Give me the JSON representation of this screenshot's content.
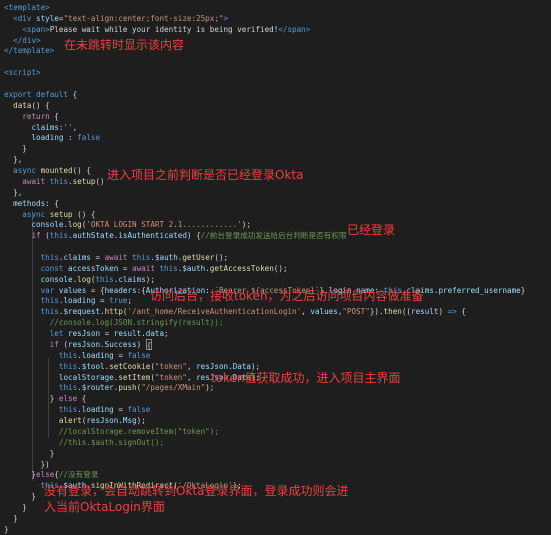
{
  "code": [
    [
      [
        "tag",
        "<template>"
      ]
    ],
    [
      [
        "txt",
        "  "
      ],
      [
        "tag",
        "<div "
      ],
      [
        "attr",
        "style"
      ],
      [
        "txt",
        "="
      ],
      [
        "str",
        "\"text-align:center;font-size:25px;\""
      ],
      [
        "tag",
        ">"
      ]
    ],
    [
      [
        "txt",
        "    "
      ],
      [
        "tag",
        "<span>"
      ],
      [
        "txt",
        "Please wait while your identity is being verified!"
      ],
      [
        "tag",
        "</span>"
      ]
    ],
    [
      [
        "txt",
        "  "
      ],
      [
        "tag",
        "</div>"
      ]
    ],
    [
      [
        "tag",
        "</template>"
      ]
    ],
    [
      [
        "txt",
        ""
      ]
    ],
    [
      [
        "tag",
        "<script>"
      ]
    ],
    [
      [
        "txt",
        ""
      ]
    ],
    [
      [
        "kw",
        "export default"
      ],
      [
        "txt",
        " {"
      ]
    ],
    [
      [
        "txt",
        "  "
      ],
      [
        "fn",
        "data"
      ],
      [
        "txt",
        "() {"
      ]
    ],
    [
      [
        "txt",
        "    "
      ],
      [
        "ctl",
        "return"
      ],
      [
        "txt",
        " {"
      ]
    ],
    [
      [
        "txt",
        "      "
      ],
      [
        "prop",
        "claims"
      ],
      [
        "txt",
        ":"
      ],
      [
        "str",
        "''"
      ],
      [
        "txt",
        ","
      ]
    ],
    [
      [
        "txt",
        "      "
      ],
      [
        "prop",
        "loading"
      ],
      [
        "txt",
        " : "
      ],
      [
        "kw",
        "false"
      ]
    ],
    [
      [
        "txt",
        "    }"
      ]
    ],
    [
      [
        "txt",
        "  },"
      ]
    ],
    [
      [
        "txt",
        "  "
      ],
      [
        "kw",
        "async"
      ],
      [
        "txt",
        " "
      ],
      [
        "fn",
        "mounted"
      ],
      [
        "txt",
        "() {"
      ]
    ],
    [
      [
        "txt",
        "    "
      ],
      [
        "ctl",
        "await"
      ],
      [
        "txt",
        " "
      ],
      [
        "kw",
        "this"
      ],
      [
        "txt",
        "."
      ],
      [
        "fn",
        "setup"
      ],
      [
        "txt",
        "()"
      ]
    ],
    [
      [
        "txt",
        "  },"
      ]
    ],
    [
      [
        "txt",
        "  "
      ],
      [
        "prop",
        "methods"
      ],
      [
        "txt",
        ": {"
      ]
    ],
    [
      [
        "txt",
        "    "
      ],
      [
        "kw",
        "async"
      ],
      [
        "txt",
        " "
      ],
      [
        "fn",
        "setup"
      ],
      [
        "txt",
        " () {"
      ]
    ],
    [
      [
        "txt",
        "      "
      ],
      [
        "prop",
        "console"
      ],
      [
        "txt",
        "."
      ],
      [
        "fn",
        "log"
      ],
      [
        "txt",
        "("
      ],
      [
        "str",
        "'OKTA LOGIN START 2.1............'"
      ],
      [
        "txt",
        ");"
      ]
    ],
    [
      [
        "txt",
        "      "
      ],
      [
        "ctl",
        "if"
      ],
      [
        "txt",
        " ("
      ],
      [
        "kw",
        "this"
      ],
      [
        "txt",
        "."
      ],
      [
        "prop",
        "authState"
      ],
      [
        "txt",
        "."
      ],
      [
        "prop",
        "isAuthenticated"
      ],
      [
        "txt",
        ") {"
      ],
      [
        "cm",
        "//前台登录成功发送给后台判断是否有权限"
      ]
    ],
    [
      [
        "txt",
        ""
      ]
    ],
    [
      [
        "txt",
        "        "
      ],
      [
        "kw",
        "this"
      ],
      [
        "txt",
        "."
      ],
      [
        "prop",
        "claims"
      ],
      [
        "txt",
        " = "
      ],
      [
        "ctl",
        "await"
      ],
      [
        "txt",
        " "
      ],
      [
        "kw",
        "this"
      ],
      [
        "txt",
        "."
      ],
      [
        "prop",
        "$auth"
      ],
      [
        "txt",
        "."
      ],
      [
        "fn",
        "getUser"
      ],
      [
        "txt",
        "();"
      ]
    ],
    [
      [
        "txt",
        "        "
      ],
      [
        "kw",
        "const"
      ],
      [
        "txt",
        " "
      ],
      [
        "prop",
        "accessToken"
      ],
      [
        "txt",
        " = "
      ],
      [
        "ctl",
        "await"
      ],
      [
        "txt",
        " "
      ],
      [
        "kw",
        "this"
      ],
      [
        "txt",
        "."
      ],
      [
        "prop",
        "$auth"
      ],
      [
        "txt",
        "."
      ],
      [
        "fn",
        "getAccessToken"
      ],
      [
        "txt",
        "();"
      ]
    ],
    [
      [
        "txt",
        "        "
      ],
      [
        "prop",
        "console"
      ],
      [
        "txt",
        "."
      ],
      [
        "fn",
        "log"
      ],
      [
        "txt",
        "("
      ],
      [
        "kw",
        "this"
      ],
      [
        "txt",
        "."
      ],
      [
        "prop",
        "claims"
      ],
      [
        "txt",
        ");"
      ]
    ],
    [
      [
        "txt",
        "        "
      ],
      [
        "kw",
        "var"
      ],
      [
        "txt",
        " "
      ],
      [
        "prop",
        "values"
      ],
      [
        "txt",
        " = {"
      ],
      [
        "prop",
        "headers"
      ],
      [
        "txt",
        ":{"
      ],
      [
        "prop",
        "Authorization"
      ],
      [
        "txt",
        ": "
      ],
      [
        "str",
        "`Bearer ${accessToken}`"
      ],
      [
        "txt",
        "},"
      ],
      [
        "prop",
        "login_name"
      ],
      [
        "txt",
        ": "
      ],
      [
        "kw",
        "this"
      ],
      [
        "txt",
        "."
      ],
      [
        "prop",
        "claims"
      ],
      [
        "txt",
        "."
      ],
      [
        "prop",
        "preferred_username"
      ],
      [
        "txt",
        "}"
      ]
    ],
    [
      [
        "txt",
        "        "
      ],
      [
        "kw",
        "this"
      ],
      [
        "txt",
        "."
      ],
      [
        "prop",
        "loading"
      ],
      [
        "txt",
        " = "
      ],
      [
        "kw",
        "true"
      ],
      [
        "txt",
        ";"
      ]
    ],
    [
      [
        "txt",
        "        "
      ],
      [
        "kw",
        "this"
      ],
      [
        "txt",
        "."
      ],
      [
        "prop",
        "$request"
      ],
      [
        "txt",
        "."
      ],
      [
        "fn",
        "http"
      ],
      [
        "txt",
        "("
      ],
      [
        "str",
        "'/ant_home/ReceiveAuthenticationLogin'"
      ],
      [
        "txt",
        ", "
      ],
      [
        "prop",
        "values"
      ],
      [
        "txt",
        ","
      ],
      [
        "str",
        "\"POST\""
      ],
      [
        "txt",
        "})."
      ],
      [
        "fn",
        "then"
      ],
      [
        "txt",
        "(("
      ],
      [
        "prop",
        "result"
      ],
      [
        "txt",
        ") "
      ],
      [
        "kw",
        "=>"
      ],
      [
        "txt",
        " {"
      ]
    ],
    [
      [
        "txt",
        "          "
      ],
      [
        "cm",
        "//console.log(JSON.stringify(result));"
      ]
    ],
    [
      [
        "txt",
        "          "
      ],
      [
        "kw",
        "let"
      ],
      [
        "txt",
        " "
      ],
      [
        "prop",
        "resJson"
      ],
      [
        "txt",
        " = "
      ],
      [
        "prop",
        "result"
      ],
      [
        "txt",
        "."
      ],
      [
        "prop",
        "data"
      ],
      [
        "txt",
        ";"
      ]
    ],
    [
      [
        "txt",
        "          "
      ],
      [
        "ctl",
        "if"
      ],
      [
        "txt",
        " ("
      ],
      [
        "prop",
        "resJson"
      ],
      [
        "txt",
        "."
      ],
      [
        "prop",
        "Success"
      ],
      [
        "txt",
        ") "
      ],
      [
        "box",
        "{"
      ]
    ],
    [
      [
        "txt",
        "            "
      ],
      [
        "kw",
        "this"
      ],
      [
        "txt",
        "."
      ],
      [
        "prop",
        "loading"
      ],
      [
        "txt",
        " = "
      ],
      [
        "kw",
        "false"
      ]
    ],
    [
      [
        "txt",
        "            "
      ],
      [
        "kw",
        "this"
      ],
      [
        "txt",
        "."
      ],
      [
        "prop",
        "$tool"
      ],
      [
        "txt",
        "."
      ],
      [
        "fn",
        "setCookie"
      ],
      [
        "txt",
        "("
      ],
      [
        "str",
        "\"token\""
      ],
      [
        "txt",
        ", "
      ],
      [
        "prop",
        "resJson"
      ],
      [
        "txt",
        "."
      ],
      [
        "prop",
        "Data"
      ],
      [
        "txt",
        ");"
      ]
    ],
    [
      [
        "txt",
        "            "
      ],
      [
        "prop",
        "localStorage"
      ],
      [
        "txt",
        "."
      ],
      [
        "fn",
        "setItem"
      ],
      [
        "txt",
        "("
      ],
      [
        "str",
        "\"token\""
      ],
      [
        "txt",
        ", "
      ],
      [
        "prop",
        "resJson"
      ],
      [
        "txt",
        "."
      ],
      [
        "prop",
        "Data"
      ],
      [
        "txt",
        ");"
      ]
    ],
    [
      [
        "txt",
        "            "
      ],
      [
        "kw",
        "this"
      ],
      [
        "txt",
        "."
      ],
      [
        "prop",
        "$router"
      ],
      [
        "txt",
        "."
      ],
      [
        "fn",
        "push"
      ],
      [
        "txt",
        "("
      ],
      [
        "str",
        "\"/pages/XMain\""
      ],
      [
        "txt",
        ");"
      ]
    ],
    [
      [
        "txt",
        "          } "
      ],
      [
        "ctl",
        "else"
      ],
      [
        "txt",
        " {"
      ]
    ],
    [
      [
        "txt",
        "            "
      ],
      [
        "kw",
        "this"
      ],
      [
        "txt",
        "."
      ],
      [
        "prop",
        "loading"
      ],
      [
        "txt",
        " = "
      ],
      [
        "kw",
        "false"
      ]
    ],
    [
      [
        "txt",
        "            "
      ],
      [
        "fn",
        "alert"
      ],
      [
        "txt",
        "("
      ],
      [
        "prop",
        "resJson"
      ],
      [
        "txt",
        "."
      ],
      [
        "prop",
        "Msg"
      ],
      [
        "txt",
        ");"
      ]
    ],
    [
      [
        "txt",
        "            "
      ],
      [
        "cm",
        "//localStorage.removeItem(\"token\");"
      ]
    ],
    [
      [
        "txt",
        "            "
      ],
      [
        "cm",
        "//this.$auth.signOut();"
      ]
    ],
    [
      [
        "txt",
        "          }"
      ]
    ],
    [
      [
        "txt",
        "        })"
      ]
    ],
    [
      [
        "txt",
        "      }"
      ],
      [
        "ctl",
        "else"
      ],
      [
        "txt",
        "{"
      ],
      [
        "cm",
        "//没有登录"
      ]
    ],
    [
      [
        "txt",
        "        "
      ],
      [
        "kw",
        "this"
      ],
      [
        "txt",
        "."
      ],
      [
        "prop",
        "$auth"
      ],
      [
        "txt",
        "."
      ],
      [
        "fn",
        "signInWithRedirect"
      ],
      [
        "txt",
        "("
      ],
      [
        "str",
        "'/OktaLogin'"
      ],
      [
        "txt",
        ");"
      ]
    ],
    [
      [
        "txt",
        "      }"
      ]
    ],
    [
      [
        "txt",
        "    }"
      ]
    ],
    [
      [
        "txt",
        "  }"
      ]
    ],
    [
      [
        "txt",
        "}"
      ]
    ]
  ],
  "annotations": {
    "template_note": "在未跳转时显示该内容",
    "mounted_note": "进入项目之前判断是否已经登录Okta",
    "logged_in_note": "已经登录",
    "request_note": "访问后台，接收token，为之后访问项目内容做准备",
    "success_note": "token值获取成功，进入项目主界面",
    "not_logged_note_line1": "没有登录，会自动跳转到Okta登录界面，登录成功则会进",
    "not_logged_note_line2": "入当前OktaLogin界面"
  },
  "colors": {
    "background": "#1e1e1e",
    "annotation": "#f13f3f"
  }
}
